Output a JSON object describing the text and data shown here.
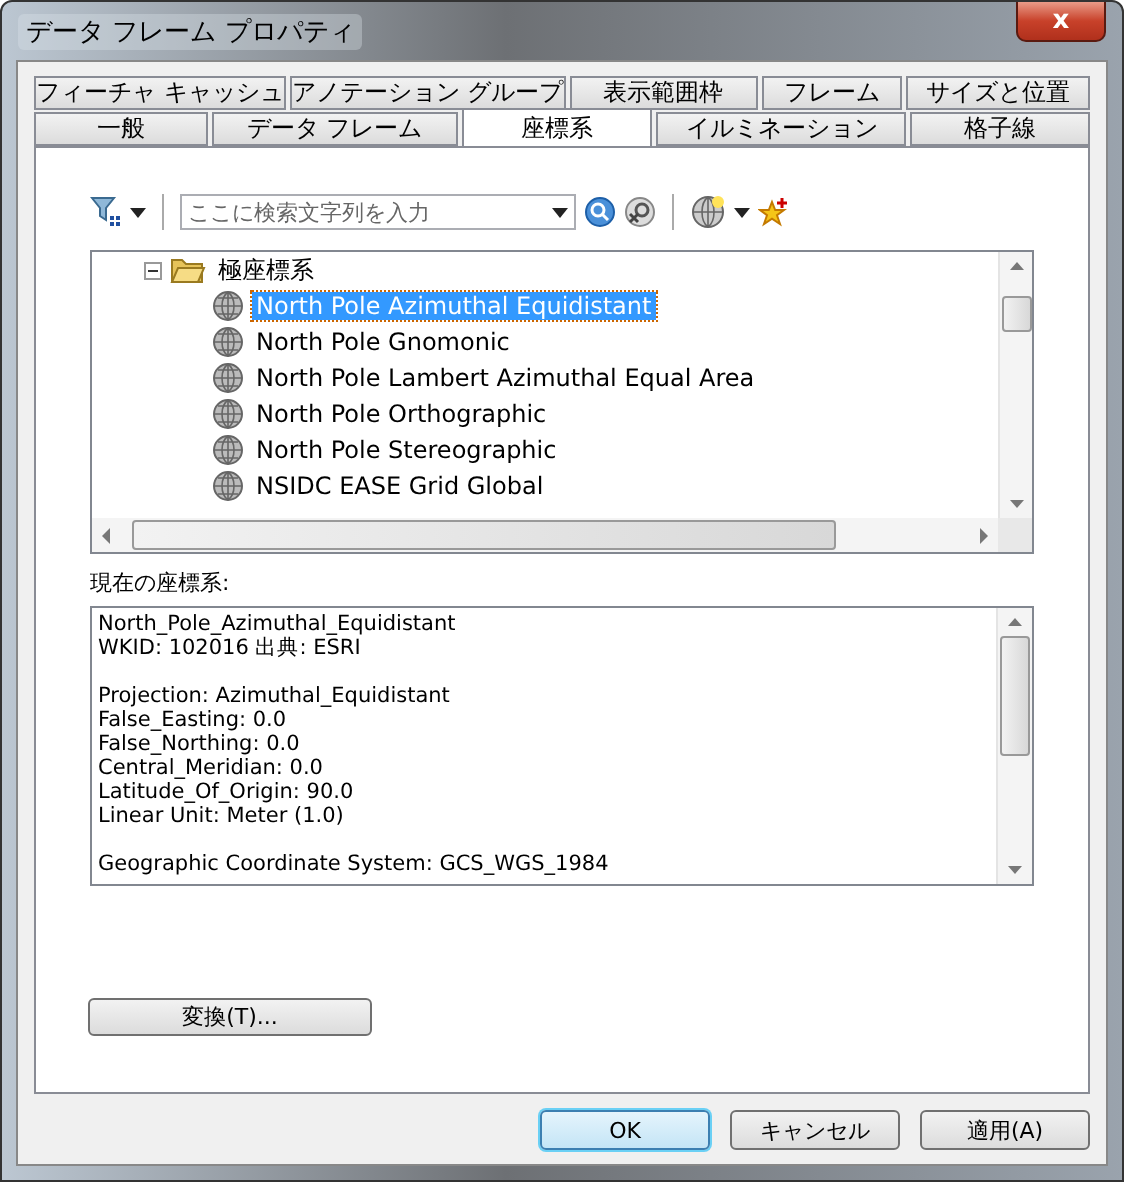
{
  "window": {
    "title": "データ フレーム プロパティ",
    "close": "x"
  },
  "tab_rows": [
    [
      {
        "label": "フィーチャ キャッシュ",
        "selected": false
      },
      {
        "label": "アノテーション グループ",
        "selected": false
      },
      {
        "label": "表示範囲枠",
        "selected": false
      },
      {
        "label": "フレーム",
        "selected": false
      },
      {
        "label": "サイズと位置",
        "selected": false
      }
    ],
    [
      {
        "label": "一般",
        "selected": false
      },
      {
        "label": "データ フレーム",
        "selected": false
      },
      {
        "label": "座標系",
        "selected": true
      },
      {
        "label": "イルミネーション",
        "selected": false
      },
      {
        "label": "格子線",
        "selected": false
      }
    ]
  ],
  "search": {
    "placeholder": "ここに検索文字列を入力"
  },
  "tree": [
    {
      "kind": "folder",
      "label": "極座標系",
      "expanded": true,
      "selected": false,
      "children": [
        {
          "kind": "projection",
          "label": "North Pole Azimuthal Equidistant",
          "selected": true
        },
        {
          "kind": "projection",
          "label": "North Pole Gnomonic",
          "selected": false
        },
        {
          "kind": "projection",
          "label": "North Pole Lambert Azimuthal Equal Area",
          "selected": false
        },
        {
          "kind": "projection",
          "label": "North Pole Orthographic",
          "selected": false
        },
        {
          "kind": "projection",
          "label": "North Pole Stereographic",
          "selected": false
        },
        {
          "kind": "projection",
          "label": "NSIDC EASE Grid Global",
          "selected": false
        }
      ]
    }
  ],
  "current": {
    "label": "現在の座標系:",
    "paragraphs": [
      [
        "North_Pole_Azimuthal_Equidistant",
        "WKID: 102016 出典: ESRI"
      ],
      [
        "Projection: Azimuthal_Equidistant",
        "False_Easting: 0.0",
        "False_Northing: 0.0",
        "Central_Meridian: 0.0",
        "Latitude_Of_Origin: 90.0",
        "Linear Unit: Meter (1.0)"
      ],
      [
        "Geographic Coordinate System: GCS_WGS_1984"
      ]
    ]
  },
  "transform_button": "変換(T)...",
  "buttons": [
    {
      "label": "OK",
      "default": true
    },
    {
      "label": "キャンセル",
      "default": false
    },
    {
      "label": "適用(A)",
      "default": false
    }
  ]
}
